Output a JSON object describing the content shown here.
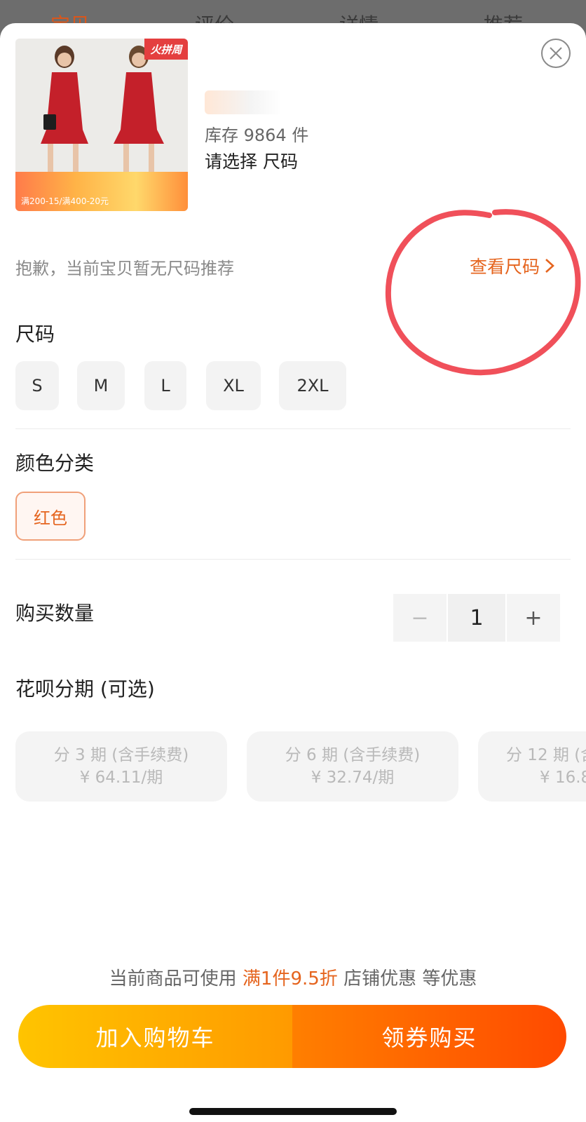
{
  "nav_tabs": [
    "宝贝",
    "评价",
    "详情",
    "推荐"
  ],
  "product": {
    "image_badge": "火拼周",
    "image_promo": "满200-15/满400-20元",
    "stock": "库存 9864 件",
    "select_hint": "请选择 尺码"
  },
  "size_recommend": {
    "message": "抱歉，当前宝贝暂无尺码推荐",
    "link": "查看尺码"
  },
  "size": {
    "title": "尺码",
    "options": [
      "S",
      "M",
      "L",
      "XL",
      "2XL"
    ]
  },
  "color": {
    "title": "颜色分类",
    "options": [
      "红色"
    ],
    "selected": "红色"
  },
  "quantity": {
    "title": "购买数量",
    "minus": "−",
    "value": "1",
    "plus": "+"
  },
  "installment": {
    "title": "花呗分期 (可选)",
    "plans": [
      {
        "label": "分 3 期 (含手续费)",
        "amount": "¥ 64.11/期"
      },
      {
        "label": "分 6 期 (含手续费)",
        "amount": "¥ 32.74/期"
      },
      {
        "label": "分 12 期 (含",
        "amount": "¥ 16.8"
      }
    ]
  },
  "promo": {
    "prefix": "当前商品可使用 ",
    "highlight": "满1件9.5折",
    "suffix": " 店铺优惠 等优惠"
  },
  "buttons": {
    "add_to_cart": "加入购物车",
    "buy": "领券购买"
  },
  "colors": {
    "accent": "#e5641e",
    "cart_start": "#ffc400",
    "buy_end": "#ff4a00",
    "annotation": "#f0505a"
  }
}
